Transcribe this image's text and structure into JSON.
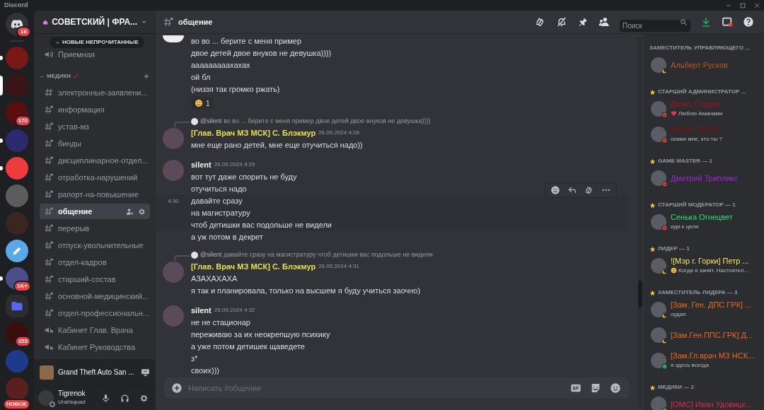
{
  "app": {
    "title": "Discord"
  },
  "home": {
    "badge": "16"
  },
  "servers": [
    {
      "kind": "image",
      "color": "#7a1818",
      "unread": true,
      "selected": false
    },
    {
      "kind": "image",
      "color": "#3b1515",
      "unread": false,
      "selected": true
    },
    {
      "kind": "image",
      "color": "#5a0e0e",
      "unread": false,
      "selected": false,
      "badge": "170"
    },
    {
      "kind": "image",
      "color": "#2b2a6e",
      "unread": true,
      "selected": false
    },
    {
      "kind": "image",
      "color": "#ef3b3b",
      "unread": true,
      "selected": false
    },
    {
      "kind": "image",
      "color": "#5c5c5c",
      "unread": false,
      "selected": false
    },
    {
      "kind": "image",
      "color": "#3a2520",
      "unread": false,
      "selected": false
    },
    {
      "kind": "pencil",
      "color": "#5aa9e6",
      "unread": false,
      "selected": false
    },
    {
      "kind": "image",
      "color": "#4a4e8a",
      "unread": true,
      "selected": false,
      "badge": "1K+"
    },
    {
      "kind": "folder",
      "color": "#5865f2",
      "unread": false,
      "selected": false
    },
    {
      "kind": "image",
      "color": "#3a0e0e",
      "unread": false,
      "selected": false,
      "badge": "153"
    },
    {
      "kind": "image",
      "color": "#1e3a8a",
      "unread": false,
      "selected": false
    },
    {
      "kind": "image",
      "color": "#5a2020",
      "unread": false,
      "selected": false,
      "badge": "НОВОЕ"
    }
  ],
  "server_header": {
    "name": "СОВЕТСКИЙ | ФРА..."
  },
  "unread_pill": "НОВЫЕ НЕПРОЧИТАННЫЕ",
  "channels_top": [
    {
      "name": "Приемная",
      "kind": "voice",
      "selected": false
    }
  ],
  "category": {
    "name": "МЕДИКИ",
    "expanded": true
  },
  "channels": [
    {
      "name": "электронные-заявлени...",
      "kind": "text",
      "selected": false
    },
    {
      "name": "информация",
      "kind": "text-locked",
      "selected": false
    },
    {
      "name": "устав-мз",
      "kind": "text-locked",
      "selected": false
    },
    {
      "name": "бинды",
      "kind": "text-locked",
      "selected": false
    },
    {
      "name": "дисциплинарное-отдел...",
      "kind": "text-locked",
      "selected": false
    },
    {
      "name": "отработка-нарушений",
      "kind": "text-locked",
      "selected": false
    },
    {
      "name": "рапорт-на-повышение",
      "kind": "text-locked",
      "selected": false
    },
    {
      "name": "общение",
      "kind": "text-locked",
      "selected": true
    },
    {
      "name": "перерыв",
      "kind": "text-locked",
      "selected": false
    },
    {
      "name": "отпуск-увольнительные",
      "kind": "text-locked",
      "selected": false
    },
    {
      "name": "отдел-кадров",
      "kind": "text-locked",
      "selected": false
    },
    {
      "name": "старший-состав",
      "kind": "text-locked",
      "selected": false
    },
    {
      "name": "основной-медицинский...",
      "kind": "text-locked",
      "selected": false
    },
    {
      "name": "отдел-профессиональн...",
      "kind": "text-locked",
      "selected": false
    },
    {
      "name": "Кабинет Глав. Врача",
      "kind": "voice-locked",
      "selected": false
    },
    {
      "name": "Кабинет Руководства",
      "kind": "voice-locked",
      "selected": false
    }
  ],
  "activity": {
    "game": "Grand Theft Auto San ..."
  },
  "user": {
    "name": "Tigrenok",
    "status_text": "Ural/squad"
  },
  "channel_header": {
    "name": "общение",
    "search_placeholder": "Поиск"
  },
  "message_groups": [
    {
      "messages": [
        {
          "lines": [
            "во во ... берите с меня пример",
            "двое детей двое внуков не девушка))))"
          ],
          "hovered": false
        },
        {
          "lines": [
            "ааааааааахахах"
          ],
          "hovered": false
        },
        {
          "lines": [
            "ой бл"
          ],
          "hovered": false
        },
        {
          "lines": [
            "(низзя так громко ржать)"
          ],
          "hovered": false,
          "reaction": {
            "count": "1"
          }
        }
      ]
    },
    {
      "reply": {
        "author": "@silent",
        "text": "во во ... берите с меня пример двое детей двое внуков не девушка))))"
      },
      "author": "[Глав. Врач МЗ МСК] С. Блэкмур",
      "color": "#e6e14a",
      "timestamp": "26.05.2024 4:28",
      "messages": [
        {
          "lines": [
            "мне еще рано детей, мне еще отучиться надо))"
          ],
          "hovered": false
        }
      ]
    },
    {
      "author": "silent",
      "color": "#f2f3f5",
      "timestamp": "26.05.2024 4:29",
      "messages": [
        {
          "lines": [
            "вот тут даже спорить не буду"
          ],
          "hovered": false
        },
        {
          "lines": [
            "отучиться надо"
          ],
          "hovered": false
        },
        {
          "time": "4:30",
          "lines": [
            "давайте сразу",
            "на магистратуру",
            "чтоб детишки вас подольше не видели"
          ],
          "hovered": true
        },
        {
          "lines": [
            "а уж потом в декрет"
          ],
          "hovered": false
        }
      ]
    },
    {
      "reply": {
        "author": "@silent",
        "text": "давайте сразу  на магистратуру  чтоб детишки вас подольше не видели"
      },
      "author": "[Глав. Врач МЗ МСК] С. Блэкмур",
      "color": "#e6e14a",
      "timestamp": "26.05.2024 4:31",
      "messages": [
        {
          "lines": [
            "АЗАХАХАХА"
          ],
          "hovered": false
        },
        {
          "lines": [
            "я так и планировала, только на высшем я буду учиться заочно)"
          ],
          "hovered": false
        }
      ]
    },
    {
      "author": "silent",
      "color": "#f2f3f5",
      "timestamp": "26.05.2024 4:32",
      "messages": [
        {
          "lines": [
            "не не стационар"
          ],
          "hovered": false
        },
        {
          "lines": [
            "переживаю за их неокрепшую психику"
          ],
          "hovered": false
        },
        {
          "lines": [
            "а уже потом детишек щаведете"
          ],
          "hovered": false
        },
        {
          "lines": [
            "з*"
          ],
          "hovered": false
        },
        {
          "lines": [
            "своих)))"
          ],
          "hovered": false
        }
      ]
    }
  ],
  "composer": {
    "placeholder": "Написать #общение"
  },
  "member_groups": [
    {
      "title": "ЗАМЕСТИТЕЛЬ УПРАВЛЯЮЩЕГО ...",
      "icon": false,
      "members": [
        {
          "name": "Альберт Русков",
          "color": "#c0561c",
          "kind": "idle"
        }
      ]
    },
    {
      "title": "СТАРШИЙ АДМИНИСТРАТОР ...",
      "icon": true,
      "members": [
        {
          "name": "Денис Гладик",
          "color": "#a3131d",
          "kind": "dnd",
          "activity": "Люблю Аманами",
          "activity_emoji": true
        },
        {
          "name": "KEVIN TRPLX",
          "color": "#8e0c0c",
          "kind": "dnd",
          "activity": "скажи мне, кто ты ?",
          "activity_emoji": false
        }
      ]
    },
    {
      "title": "GAME MASTER — 1",
      "icon": true,
      "members": [
        {
          "name": "Дмитрий Трипликс",
          "color": "#9c27d9",
          "kind": "dnd"
        }
      ]
    },
    {
      "title": "СТАРШИЙ МОДЕРАТОР — 1",
      "icon": true,
      "members": [
        {
          "name": "Сенька Огнецвет",
          "color": "#2ee07a",
          "kind": "dnd",
          "activity": "иди к цели",
          "activity_emoji": false
        }
      ]
    },
    {
      "title": "ЛИДЕР — 1",
      "icon": true,
      "members": [
        {
          "name": "![Мэр г. Горки] Петр ...",
          "color": "#f2e85a",
          "kind": "idle",
          "activity": "Когда я занят. Настоятел...",
          "activity_emoji": true
        }
      ]
    },
    {
      "title": "ЗАМЕСТИТЕЛЬ ЛИДЕРА — 3",
      "icon": true,
      "members": [
        {
          "name": "[Зам. Ген. ДПС ГРК] ...",
          "color": "#ec6a1c",
          "kind": "idle",
          "activity": "оудап",
          "activity_emoji": false
        },
        {
          "name": "[Зам.Ген.ППС.ГРК] Д...",
          "color": "#ec6a1c",
          "kind": "idle"
        },
        {
          "name": "[Зам.Гл.врач МЗ НСК...",
          "color": "#ec6a1c",
          "kind": "online",
          "activity": "я здесь всегда",
          "activity_emoji": false
        }
      ]
    },
    {
      "title": "МЕДИКИ — 2",
      "icon": true,
      "members": [
        {
          "name": "[ОМС] Иван Удовицк...",
          "color": "#e0245e",
          "kind": "online"
        }
      ]
    }
  ]
}
